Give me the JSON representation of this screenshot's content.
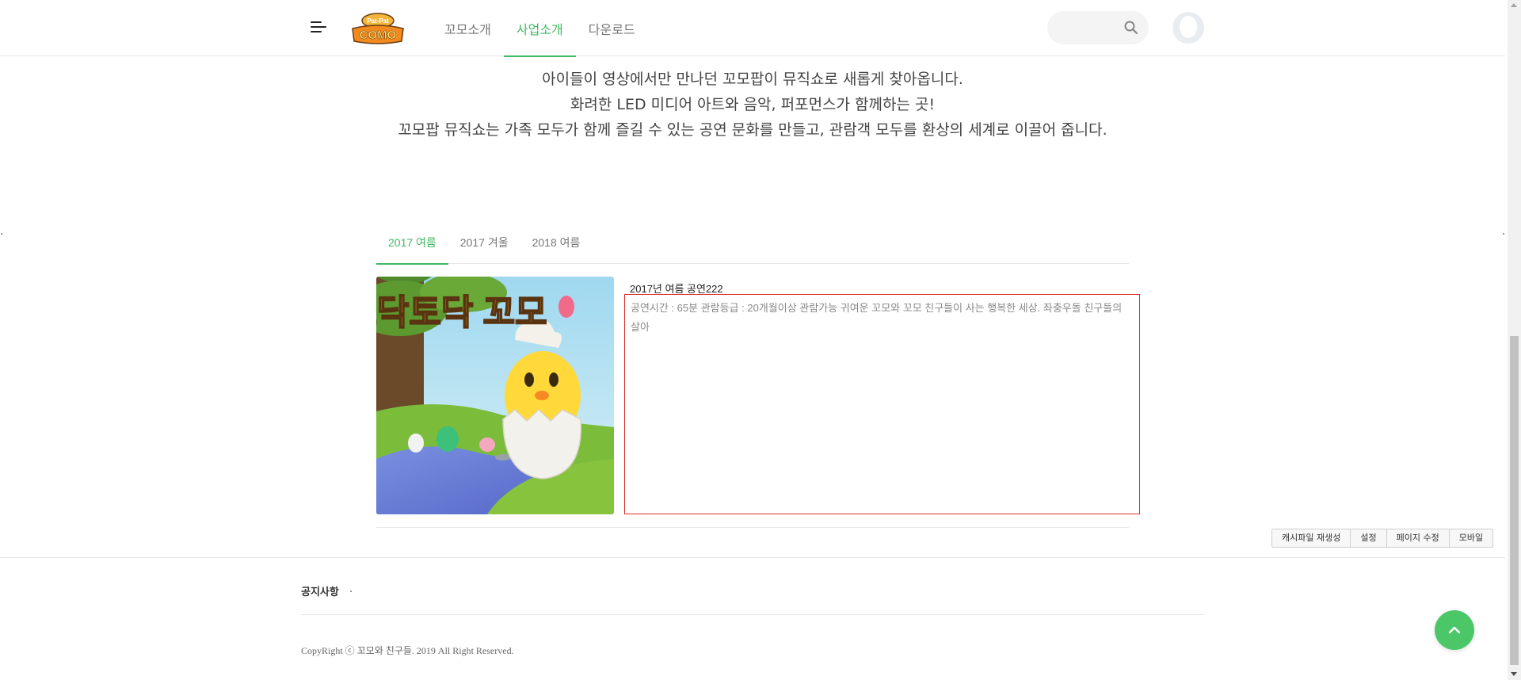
{
  "header": {
    "logo_text": "COMO",
    "logo_subtext": "Pat-Pat",
    "nav": [
      {
        "label": "꼬모소개",
        "active": false
      },
      {
        "label": "사업소개",
        "active": true
      },
      {
        "label": "다운로드",
        "active": false
      }
    ],
    "search_placeholder": ""
  },
  "intro": {
    "lines": [
      "아이들이 영상에서만 만나던 꼬모팝이 뮤직쇼로 새롭게 찾아옵니다.",
      "화려한 LED 미디어 아트와 음악, 퍼포먼스가 함께하는 곳!",
      "꼬모팝 뮤직쇼는 가족 모두가 함께 즐길 수 있는 공연 문화를 만들고, 관람객 모두를 환상의 세계로 이끌어 줍니다."
    ]
  },
  "tabs": [
    {
      "label": "2017 여름",
      "active": true
    },
    {
      "label": "2017 겨울",
      "active": false
    },
    {
      "label": "2018 여름",
      "active": false
    }
  ],
  "show": {
    "image_title": "토닥토닥 꼬모",
    "title": "2017년 여름 공연222",
    "description": "공연시간 : 65분 관람등급 : 20개월이상 관람가능 귀여운 꼬모와 꼬모 친구들이 사는 행복한 세상. 좌충우돌 친구들의 살아"
  },
  "admin_buttons": [
    "캐시파일 재생성",
    "설정",
    "페이지 수정",
    "모바일"
  ],
  "footer": {
    "notice_label": "공지사항",
    "notice_text": ".",
    "copyright": "CopyRight ⓒ 꼬모와 친구들. 2019 All Right Reserved."
  },
  "colors": {
    "accent": "#3fba63",
    "top_button": "#4cc767",
    "highlight_border": "#d92c2c"
  },
  "icons": {
    "menu": "hamburger-icon",
    "search": "search-icon",
    "avatar": "user-icon",
    "top": "arrow-up-icon"
  }
}
